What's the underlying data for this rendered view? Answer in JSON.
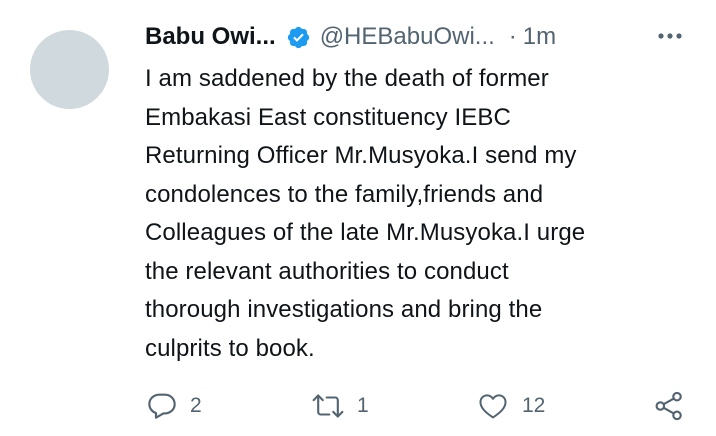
{
  "tweet": {
    "author_name": "Babu Owi...",
    "handle": "@HEBabuOwi...",
    "separator": "·",
    "time": "1m",
    "text_lines": [
      "I am saddened by the death of former",
      "Embakasi East constituency IEBC",
      "Returning Officer Mr.Musyoka.I send my",
      "condolences to the family,friends and",
      "Colleagues of the late Mr.Musyoka.I urge",
      "the relevant authorities to conduct",
      "thorough investigations and bring the",
      "culprits to book."
    ],
    "counts": {
      "replies": "2",
      "retweets": "1",
      "likes": "12"
    }
  },
  "icons": {
    "verified": "verified-badge-icon",
    "more": "more-dots-icon",
    "reply": "reply-icon",
    "retweet": "retweet-icon",
    "like": "heart-icon",
    "share": "share-icon"
  },
  "colors": {
    "verified_blue": "#1d9bf0",
    "secondary_text": "#536471",
    "avatar_placeholder": "#cfd9de"
  }
}
